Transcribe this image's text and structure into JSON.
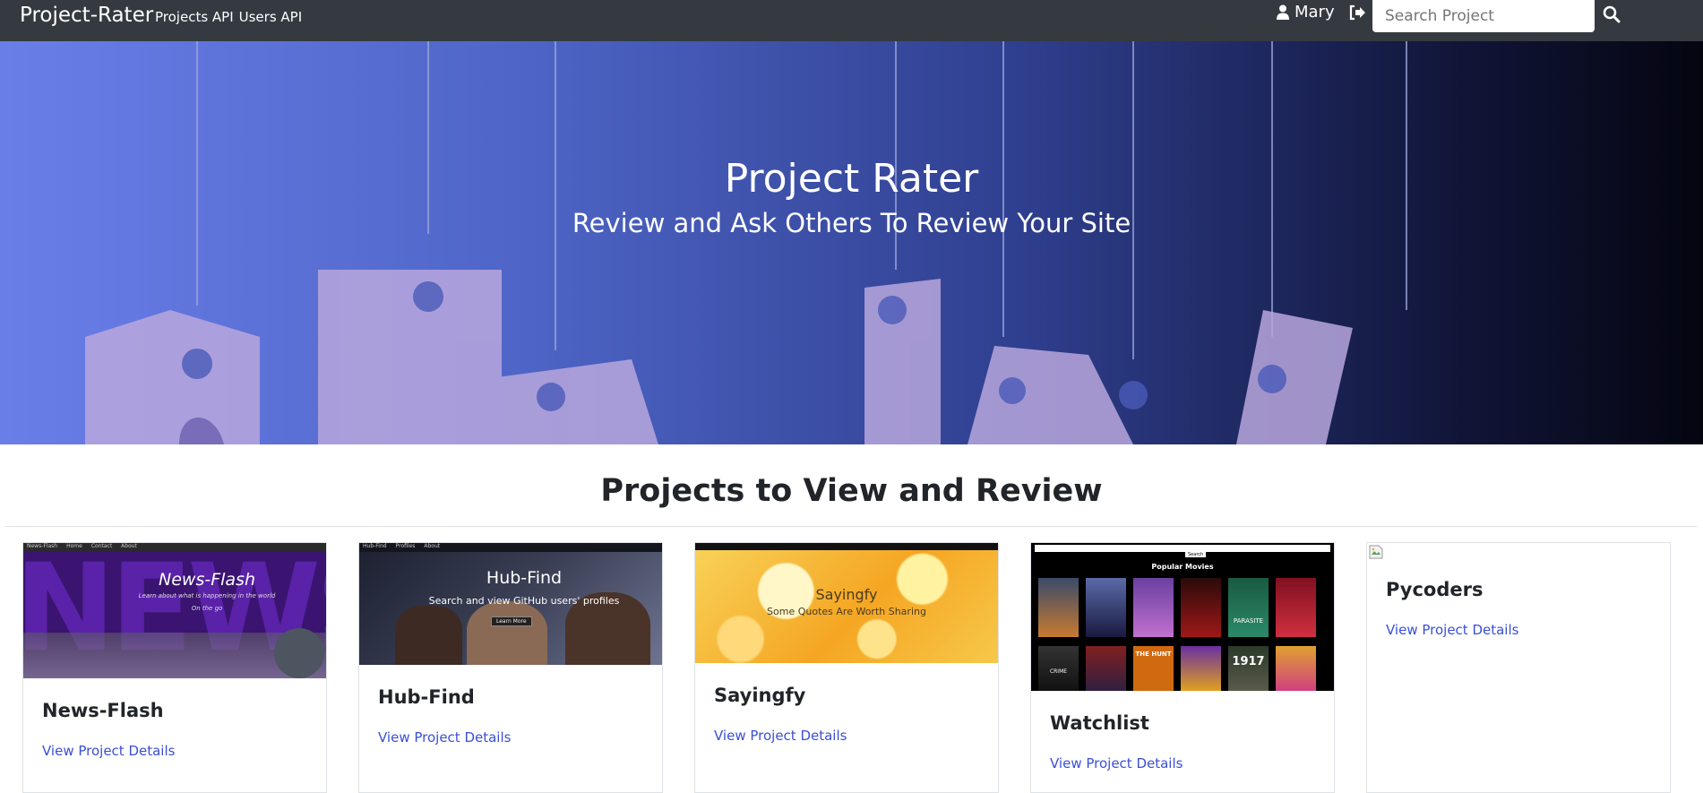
{
  "navbar": {
    "brand": "Project-Rater",
    "links": [
      "Projects API",
      "Users API"
    ],
    "user_name": "Mary",
    "search_placeholder": "Search Project"
  },
  "hero": {
    "title": "Project Rater",
    "subtitle": "Review and Ask Others To Review Your Site"
  },
  "section": {
    "title": "Projects to View and Review"
  },
  "projects": [
    {
      "title": "News-Flash",
      "link": "View Project Details",
      "thumb": {
        "heading": "News-Flash",
        "tagline": "Learn about what is happening in the world",
        "sub": "On the go",
        "nav": [
          "News-Flash",
          "Home",
          "Contact",
          "About"
        ]
      }
    },
    {
      "title": "Hub-Find",
      "link": "View Project Details",
      "thumb": {
        "heading": "Hub-Find",
        "tagline": "Search and view GitHub users' profiles",
        "button": "Learn More",
        "nav": [
          "Hub-Find",
          "Profiles",
          "About"
        ]
      }
    },
    {
      "title": "Sayingfy",
      "link": "View Project Details",
      "thumb": {
        "heading": "Sayingfy",
        "tagline": "Some Quotes Are Worth Sharing"
      }
    },
    {
      "title": "Watchlist",
      "link": "View Project Details",
      "thumb": {
        "heading": "Popular Movies",
        "search_label": "Search",
        "posters": [
          "PARASITE",
          "THE HUNT",
          "1917",
          "CRIME"
        ]
      }
    },
    {
      "title": "Pycoders",
      "link": "View Project Details"
    }
  ],
  "colors": {
    "navbar": "#343a40",
    "link": "#3a4fd6",
    "hero_start": "#6a7ee8",
    "hero_end": "#050510"
  }
}
